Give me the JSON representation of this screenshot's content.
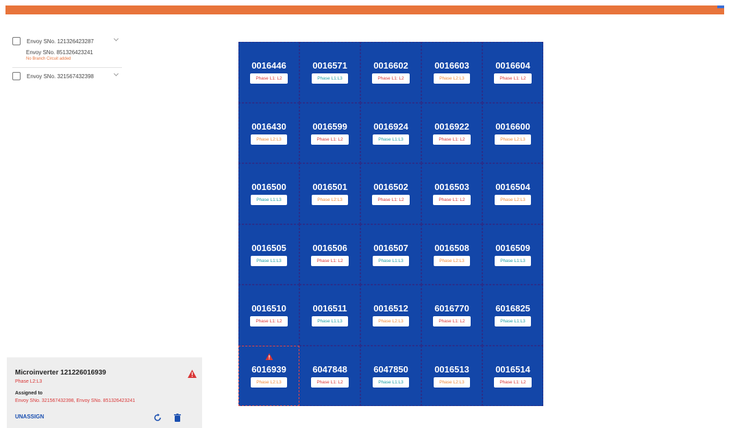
{
  "colors": {
    "accent_bar": "#e8743b",
    "grid_bg": "#1346a8",
    "phase_l1l2": "#d93636",
    "phase_l1l3": "#1c9fa6",
    "phase_l2l3": "#f08c3a"
  },
  "envoys": [
    {
      "label": "Envoy SNo. 121326423287",
      "expanded": false
    },
    {
      "label": "Envoy SNo. 851326423241",
      "note": "No Branch Circuit added"
    },
    {
      "label": "Envoy SNo. 321567432398",
      "expanded": false
    }
  ],
  "grid": {
    "rows": [
      [
        {
          "id": "0016446",
          "phase": "Phase L1: L2",
          "cls": "l1l2"
        },
        {
          "id": "0016571",
          "phase": "Phase L1:L3",
          "cls": "l1l3"
        },
        {
          "id": "0016602",
          "phase": "Phase L1: L2",
          "cls": "l1l2"
        },
        {
          "id": "0016603",
          "phase": "Phase L2:L3",
          "cls": "l2l3"
        },
        {
          "id": "0016604",
          "phase": "Phase L1: L2",
          "cls": "l1l2"
        }
      ],
      [
        {
          "id": "0016430",
          "phase": "Phase L2:L3",
          "cls": "l2l3"
        },
        {
          "id": "0016599",
          "phase": "Phase L1: L2",
          "cls": "l1l2"
        },
        {
          "id": "0016924",
          "phase": "Phase L1:L3",
          "cls": "l1l3"
        },
        {
          "id": "0016922",
          "phase": "Phase L1: L2",
          "cls": "l1l2"
        },
        {
          "id": "0016600",
          "phase": "Phase L2:L3",
          "cls": "l2l3"
        }
      ],
      [
        {
          "id": "0016500",
          "phase": "Phase L1:L3",
          "cls": "l1l3"
        },
        {
          "id": "0016501",
          "phase": "Phase L2:L3",
          "cls": "l2l3"
        },
        {
          "id": "0016502",
          "phase": "Phase L1: L2",
          "cls": "l1l2"
        },
        {
          "id": "0016503",
          "phase": "Phase L1: L2",
          "cls": "l1l2"
        },
        {
          "id": "0016504",
          "phase": "Phase L2:L3",
          "cls": "l2l3"
        }
      ],
      [
        {
          "id": "0016505",
          "phase": "Phase L1:L3",
          "cls": "l1l3"
        },
        {
          "id": "0016506",
          "phase": "Phase L1: L2",
          "cls": "l1l2"
        },
        {
          "id": "0016507",
          "phase": "Phase L1:L3",
          "cls": "l1l3"
        },
        {
          "id": "0016508",
          "phase": "Phase L2:L3",
          "cls": "l2l3"
        },
        {
          "id": "0016509",
          "phase": "Phase L1:L3",
          "cls": "l1l3"
        }
      ],
      [
        {
          "id": "0016510",
          "phase": "Phase L1: L2",
          "cls": "l1l2"
        },
        {
          "id": "0016511",
          "phase": "Phase L1:L3",
          "cls": "l1l3"
        },
        {
          "id": "0016512",
          "phase": "Phase L2:L3",
          "cls": "l2l3"
        },
        {
          "id": "6016770",
          "phase": "Phase L1: L2",
          "cls": "l1l2"
        },
        {
          "id": "6016825",
          "phase": "Phase L1:L3",
          "cls": "l1l3"
        }
      ],
      [
        {
          "id": "6016939",
          "phase": "Phase L2:L3",
          "cls": "l2l3",
          "selected": true,
          "alert": true
        },
        {
          "id": "6047848",
          "phase": "Phase L1: L2",
          "cls": "l1l2"
        },
        {
          "id": "6047850",
          "phase": "Phase L1:L3",
          "cls": "l1l3"
        },
        {
          "id": "0016513",
          "phase": "Phase L2:L3",
          "cls": "l2l3"
        },
        {
          "id": "0016514",
          "phase": "Phase L1: L2",
          "cls": "l1l2"
        }
      ]
    ]
  },
  "detail": {
    "title": "Microinverter 121226016939",
    "phase": "Phase L2:L3",
    "assigned_label": "Assigned to",
    "assigned_value": "Envoy SNo. 321567432398, Envoy SNo. 851326423241",
    "unassign_label": "UNASSIGN",
    "icons": {
      "alert": "alert-triangle-icon",
      "refresh": "refresh-icon",
      "delete": "trash-icon"
    }
  }
}
